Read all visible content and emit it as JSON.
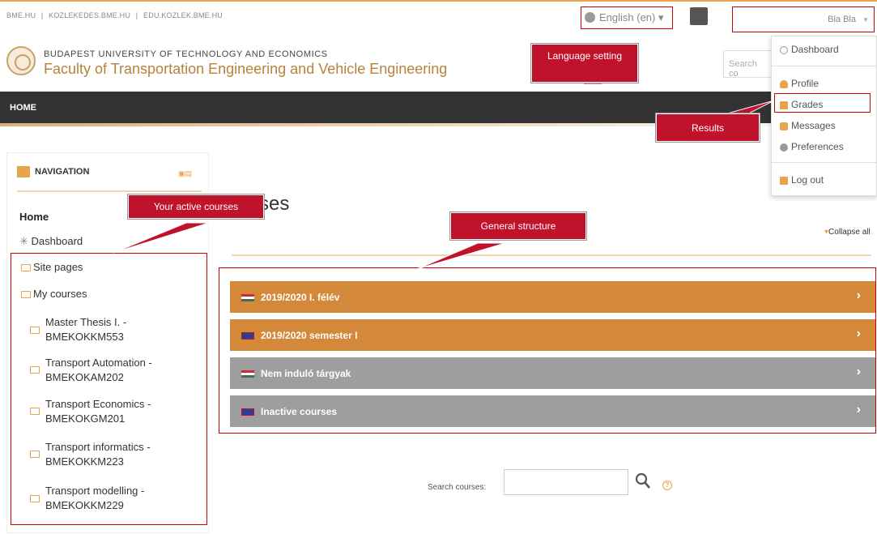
{
  "top_links": [
    "BME.HU",
    "|",
    "KOZLEKEDES.BME.HU",
    "|",
    "EDU.KOZLEK.BME.HU"
  ],
  "language": "English (en) ▾",
  "user_name": "Bla Bla",
  "header": {
    "university": "BUDAPEST UNIVERSITY OF TECHNOLOGY AND ECONOMICS",
    "faculty": "Faculty of Transportation Engineering and Vehicle Engineering",
    "search_placeholder": "Search co"
  },
  "navbar": {
    "home": "HOME"
  },
  "user_menu": {
    "dashboard": "Dashboard",
    "profile": "Profile",
    "grades": "Grades",
    "messages": "Messages",
    "preferences": "Preferences",
    "logout": "Log out"
  },
  "navigation": {
    "title": "NAVIGATION",
    "home": "Home",
    "dashboard": "Dashboard",
    "site_pages": "Site pages",
    "my_courses": "My courses",
    "courses": [
      {
        "line1": "Master Thesis I. -",
        "line2": "BMEKOKKM553"
      },
      {
        "line1": "Transport Automation -",
        "line2": "BMEKOKAM202"
      },
      {
        "line1": "Transport Economics -",
        "line2": "BMEKOKGM201"
      },
      {
        "line1": "Transport informatics -",
        "line2": "BMEKOKKM223"
      },
      {
        "line1": "Transport modelling -",
        "line2": "BMEKOKKM229"
      }
    ]
  },
  "main": {
    "title_fragment": "ses",
    "collapse_all": "Collapse all",
    "categories": [
      {
        "label": "2019/2020 I. félév",
        "color": "#d4883a",
        "flag": "hu"
      },
      {
        "label": "2019/2020 semester I",
        "color": "#d4883a",
        "flag": "uk"
      },
      {
        "label": "Nem induló tárgyak",
        "color": "#9e9e9e",
        "flag": "hu"
      },
      {
        "label": "Inactive courses",
        "color": "#9e9e9e",
        "flag": "uk"
      }
    ],
    "search_label": "Search courses:"
  },
  "callouts": {
    "language": "Language setting",
    "results": "Results",
    "active_courses": "Your active courses",
    "general_structure": "General structure"
  },
  "colors": {
    "accent": "#e8a44a",
    "callout": "#c0122b",
    "highlight_border": "#cc0000",
    "navbar": "#333333"
  }
}
